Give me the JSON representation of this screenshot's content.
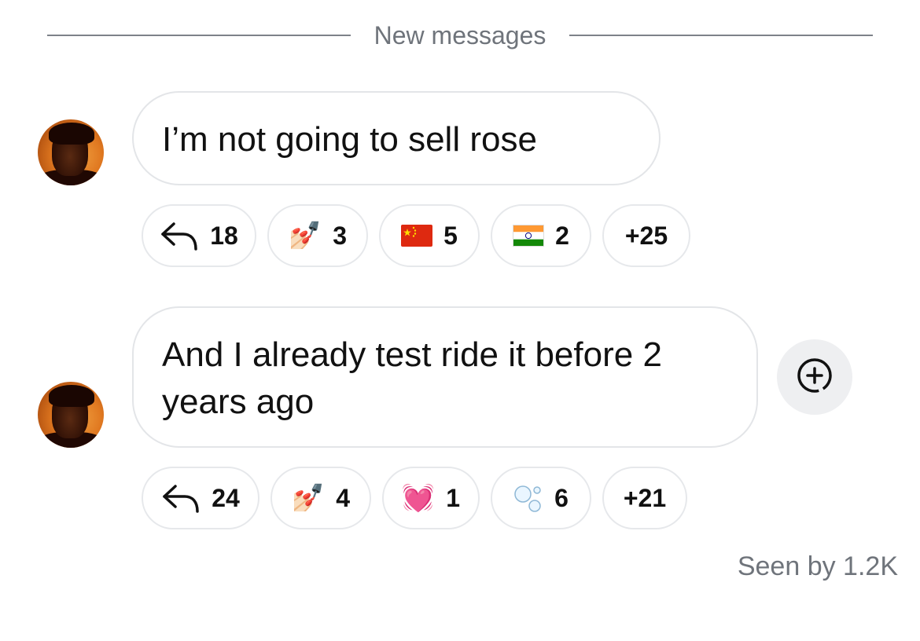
{
  "divider": {
    "label": "New messages"
  },
  "messages": [
    {
      "text": "I’m not going to sell rose",
      "reactions": [
        {
          "icon": "reply-arrow-icon",
          "count": "18"
        },
        {
          "emoji": "💅🏻",
          "icon": "nail-polish-icon",
          "count": "3"
        },
        {
          "emoji": "🇨🇳",
          "icon": "china-flag-icon",
          "count": "5"
        },
        {
          "emoji": "🇮🇳",
          "icon": "india-flag-icon",
          "count": "2"
        },
        {
          "more": "+25"
        }
      ]
    },
    {
      "text": "And I already test ride it before 2 years ago",
      "reactions": [
        {
          "icon": "reply-arrow-icon",
          "count": "24"
        },
        {
          "emoji": "💅🏻",
          "icon": "nail-polish-icon",
          "count": "4"
        },
        {
          "emoji": "💓",
          "icon": "beating-heart-icon",
          "count": "1"
        },
        {
          "emoji": "🫧",
          "icon": "bubbles-icon",
          "count": "6"
        },
        {
          "more": "+21"
        }
      ]
    }
  ],
  "add_reaction": {
    "icon": "add-reaction-icon"
  },
  "seen": "Seen by 1.2K"
}
